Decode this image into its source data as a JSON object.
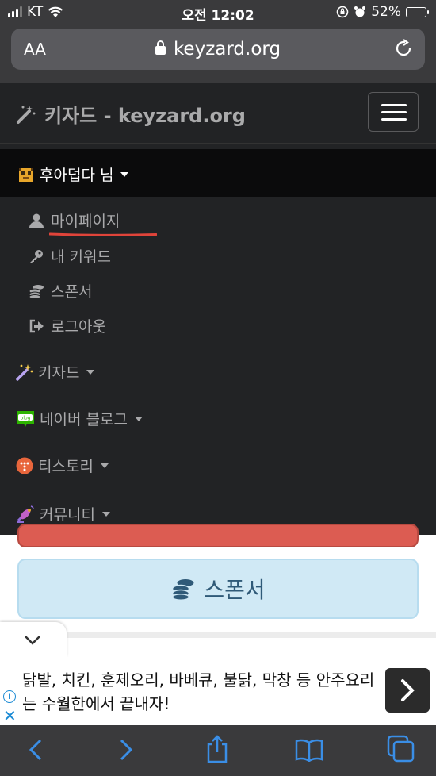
{
  "status": {
    "carrier": "KT",
    "time": "오전 12:02",
    "battery": "52%",
    "battery_level": 0.52
  },
  "browser": {
    "aa_label": "AA",
    "url": "keyzard.org"
  },
  "navbar": {
    "brand": "키자드 - keyzard.org",
    "user_label": "후아덥다 님",
    "user_submenu": [
      {
        "label": "마이페이지",
        "icon": "user-icon"
      },
      {
        "label": "내 키워드",
        "icon": "key-icon"
      },
      {
        "label": "스폰서",
        "icon": "coins-icon"
      },
      {
        "label": "로그아웃",
        "icon": "sign-out-icon"
      }
    ],
    "menus": [
      {
        "label": "키자드",
        "icon": "magic-wand-icon"
      },
      {
        "label": "네이버 블로그",
        "icon": "naver-blog-icon"
      },
      {
        "label": "티스토리",
        "icon": "tistory-icon"
      },
      {
        "label": "커뮤니티",
        "icon": "satellite-icon"
      }
    ]
  },
  "page": {
    "sponsor_button": "스폰서"
  },
  "ad": {
    "text": "닭발, 치킨, 훈제오리, 바베큐, 불닭, 막창 등 안주요리는 수월한에서 끝내자!",
    "info": "i",
    "close": "✕"
  },
  "colors": {
    "nav_bg": "#222325",
    "accent_red": "#e0443a",
    "sponsor_bg": "#d0e9f5",
    "link_blue": "#1a8ad4"
  }
}
